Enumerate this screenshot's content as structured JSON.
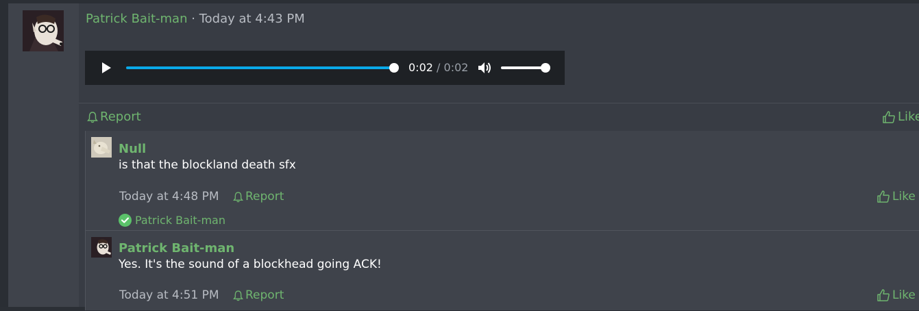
{
  "post": {
    "author": "Patrick Bait-man",
    "separator": "·",
    "timestamp": "Today at 4:43 PM",
    "audio": {
      "current_time": "0:02",
      "time_separator": "/",
      "duration": "0:02",
      "progress": 1.0,
      "volume": 1.0
    },
    "actions": {
      "report": "Report",
      "like": "Like"
    }
  },
  "comments": [
    {
      "author": "Null",
      "text": "is that the blockland death sfx",
      "timestamp": "Today at 4:48 PM",
      "report": "Report",
      "like": "Like",
      "liked_by": "Patrick Bait-man"
    },
    {
      "author": "Patrick Bait-man",
      "text": "Yes. It's the sound of a blockhead going ACK!",
      "timestamp": "Today at 4:51 PM",
      "report": "Report",
      "like": "Like"
    }
  ],
  "colors": {
    "accent_green": "#6fb56f",
    "seek_blue": "#0aa9e8",
    "panel": "#383c44",
    "comment_bg": "#3f434b",
    "player_bg": "#1e2125"
  },
  "icons": [
    "avatar",
    "play-icon",
    "volume-icon",
    "bell-icon",
    "thumbs-up-icon",
    "check-icon"
  ]
}
